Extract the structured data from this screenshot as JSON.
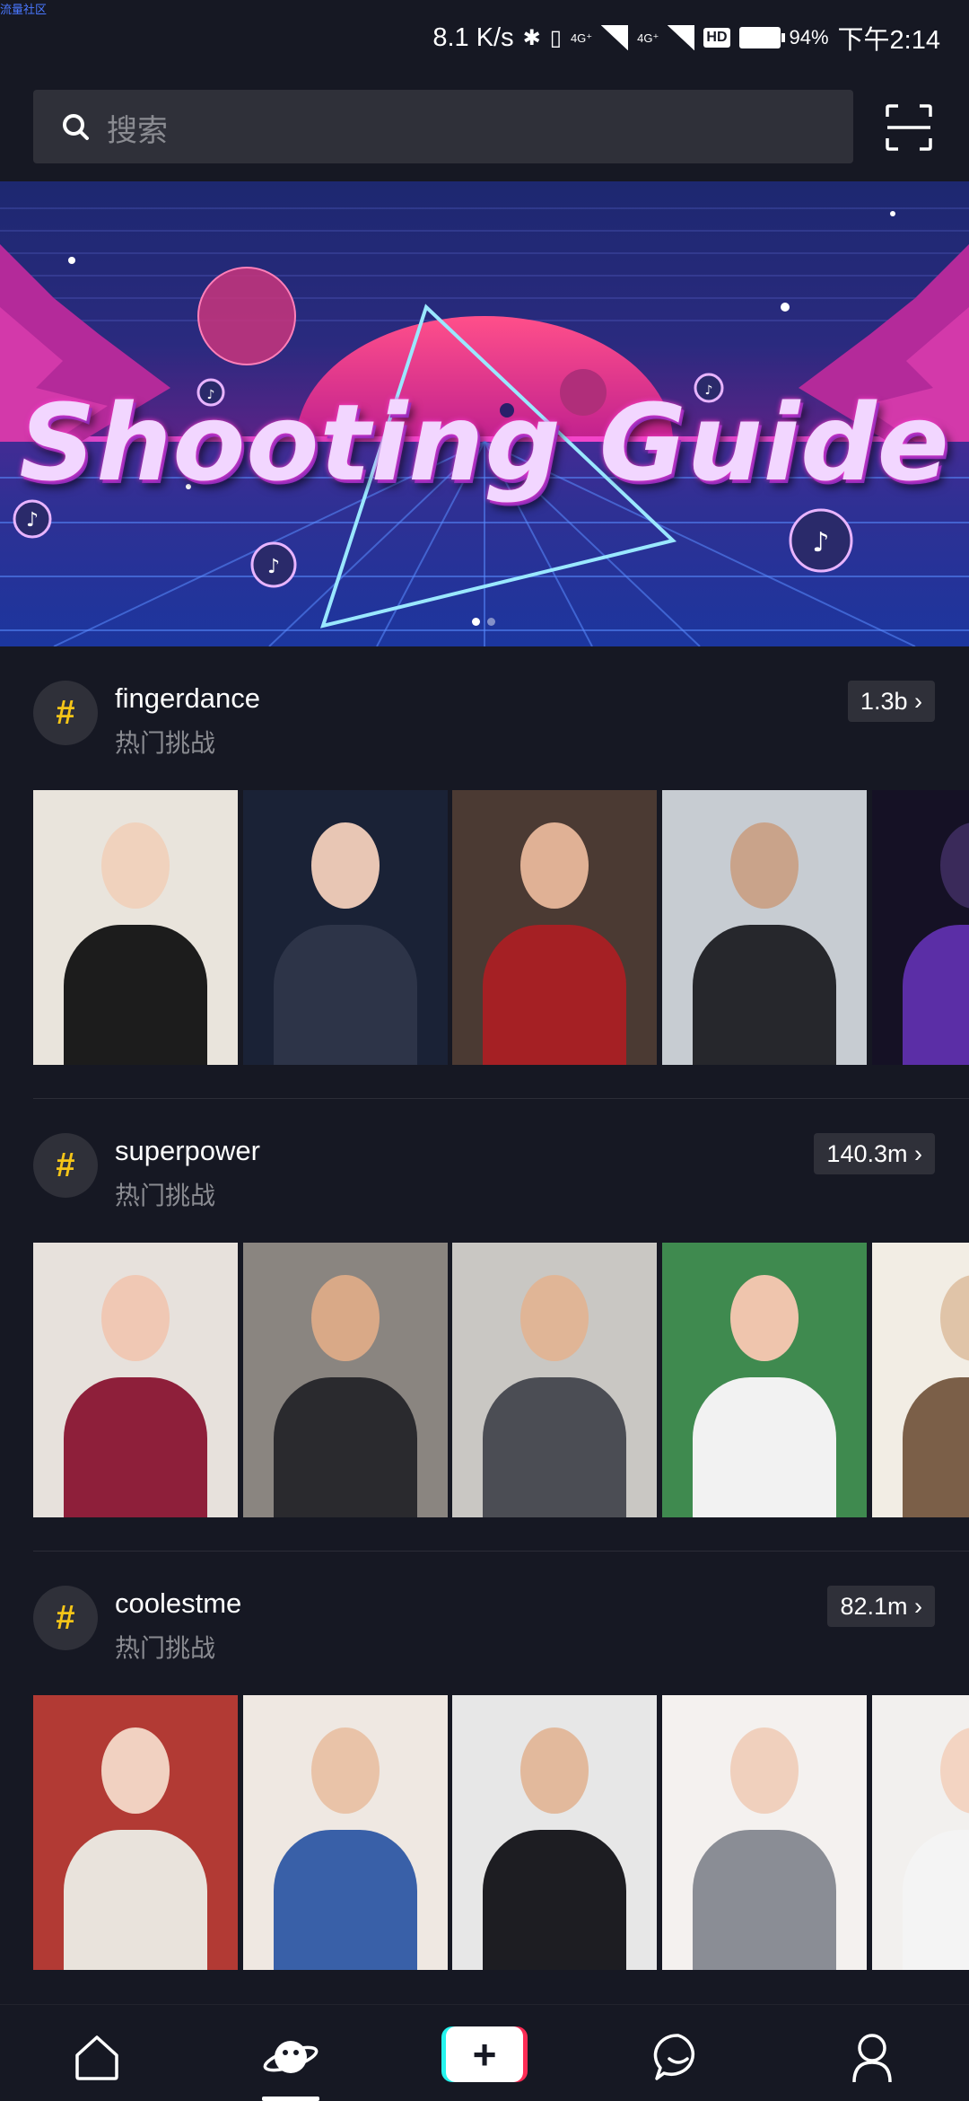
{
  "status_bar": {
    "corner_text": "流量社区",
    "speed": "8.1 K/s",
    "network_a": "4G⁺",
    "network_b": "4G⁺",
    "hd_label": "HD",
    "battery": "94%",
    "time": "下午2:14"
  },
  "search": {
    "placeholder": "搜索"
  },
  "banner": {
    "title": "Shooting Guide",
    "page_count": 2,
    "active_page": 1
  },
  "challenges": [
    {
      "name": "fingerdance",
      "subtitle": "热门挑战",
      "count": "1.3b",
      "thumbnails": [
        {
          "bg": "#e9e4dc",
          "fg": "#1c1c1c",
          "skin": "#f0d2bd"
        },
        {
          "bg": "#1a2236",
          "fg": "#2d3448",
          "skin": "#e8c6b4"
        },
        {
          "bg": "#4b3a33",
          "fg": "#a52024",
          "skin": "#e0b195"
        },
        {
          "bg": "#c7ccd2",
          "fg": "#26272c",
          "skin": "#c9a38a"
        },
        {
          "bg": "#151125",
          "fg": "#5b2ea6",
          "skin": "#3a2a5a"
        }
      ]
    },
    {
      "name": "superpower",
      "subtitle": "热门挑战",
      "count": "140.3m",
      "thumbnails": [
        {
          "bg": "#e7e1dc",
          "fg": "#8e1f3a",
          "skin": "#f0c8b4"
        },
        {
          "bg": "#8a8580",
          "fg": "#2a2a2e",
          "skin": "#d9a987"
        },
        {
          "bg": "#c9c7c3",
          "fg": "#4b4d54",
          "skin": "#e0b596"
        },
        {
          "bg": "#3f8a4f",
          "fg": "#f2f2f2",
          "skin": "#efc5ad"
        },
        {
          "bg": "#f2ede4",
          "fg": "#7b5f48",
          "skin": "#e0c4a8"
        }
      ]
    },
    {
      "name": "coolestme",
      "subtitle": "热门挑战",
      "count": "82.1m",
      "thumbnails": [
        {
          "bg": "#b23a34",
          "fg": "#e9e3dc",
          "skin": "#f1d1c1"
        },
        {
          "bg": "#efe8e2",
          "fg": "#3960a8",
          "skin": "#e9c3a8"
        },
        {
          "bg": "#e7e7e7",
          "fg": "#1d1d22",
          "skin": "#e2b99c"
        },
        {
          "bg": "#f4f1ef",
          "fg": "#8a8d95",
          "skin": "#f0d0bd"
        },
        {
          "bg": "#f2f0ee",
          "fg": "#f4f4f4",
          "skin": "#f3d4c2"
        }
      ]
    }
  ],
  "nav": {
    "items": [
      "home-icon",
      "discover-icon",
      "create-icon",
      "inbox-icon",
      "me-icon"
    ],
    "active": "discover-icon",
    "create_label": "+"
  },
  "colors": {
    "background": "#161823",
    "surface": "#2f3039",
    "hashtag": "#f5c518",
    "muted_text": "#8a8b91",
    "accent_cyan": "#25f4ee",
    "accent_red": "#fe2c55"
  }
}
